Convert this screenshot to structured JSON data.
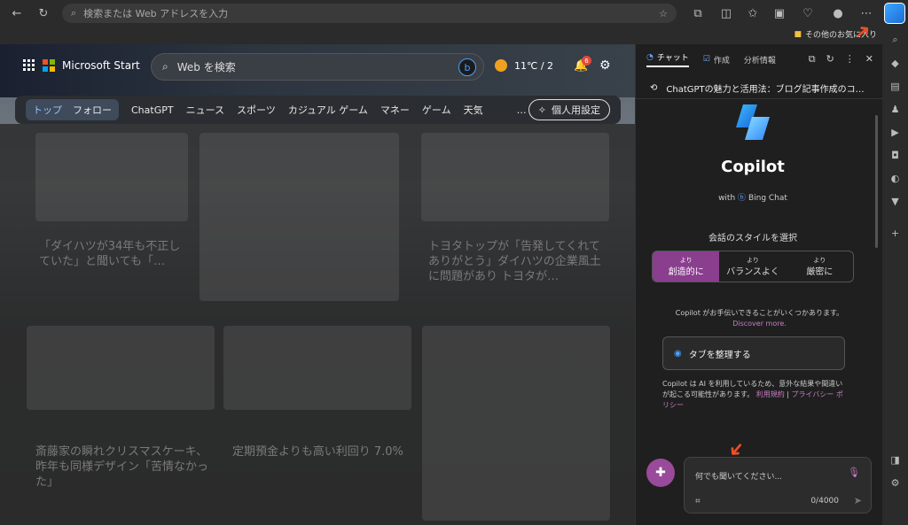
{
  "browser": {
    "address_placeholder": "検索または Web アドレスを入力",
    "bookmark_folder": "その他のお気に入り"
  },
  "msn": {
    "brand": "Microsoft Start",
    "search_placeholder": "Web を検索",
    "weather": "11℃ / 2",
    "notifications_count": "6",
    "nav_items": [
      "トップ",
      "フォロー",
      "ChatGPT",
      "ニュース",
      "スポーツ",
      "カジュアル ゲーム",
      "マネー",
      "ゲーム",
      "天気",
      "…"
    ],
    "personal_label": "個人用設定",
    "cards": {
      "card1": "「ダイハツが34年も不正していた」と聞いても「…",
      "card2": "トヨタトップが「告発してくれてありがとう」ダイハツの企業風土に問題があり トヨタが…",
      "card3": "斎藤家の瞬れクリスマスケーキ、昨年も同様デザイン「苦情なかった」",
      "card4": "定期預金よりも高い利回り 7.0%"
    }
  },
  "copilot": {
    "tabs": [
      "チャット",
      "作成",
      "分析情報"
    ],
    "history_title": "ChatGPTの魅力と活用法：ブログ記事作成のコ…",
    "title": "Copilot",
    "with_label": "with",
    "bing_chat": "Bing Chat",
    "style_label": "会話のスタイルを選択",
    "styles": [
      {
        "small": "より",
        "label": "創造的に"
      },
      {
        "small": "より",
        "label": "バランスよく"
      },
      {
        "small": "より",
        "label": "厳密に"
      }
    ],
    "help_text": "Copilot がお手伝いできることがいくつかあります。",
    "discover": "Discover more.",
    "organize_tabs": "タブを整理する",
    "disclaimer": "Copilot は AI を利用しているため、意外な結果や間違いが起こる可能性があります。",
    "terms": "利用規約",
    "privacy": "プライバシー ポリシー",
    "input_placeholder": "何でも聞いてください...",
    "char_count": "0/4000"
  },
  "colors": {
    "accent": "#8a3e8e",
    "link": "#c77ec3",
    "arrow": "#e8502a"
  }
}
